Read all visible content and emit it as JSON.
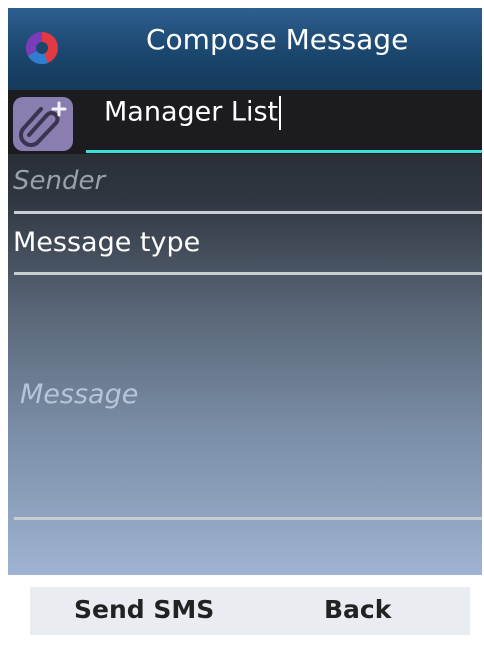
{
  "header": {
    "title": "Compose Message",
    "logo_icon": "app-logo-icon"
  },
  "form": {
    "attach_icon": "paperclip-add-icon",
    "recipient_value": "Manager List",
    "sender_placeholder": "Sender",
    "message_type_label": "Message type",
    "message_placeholder": "Message"
  },
  "softkeys": {
    "left_label": "Send SMS",
    "right_label": "Back"
  },
  "colors": {
    "header": "#1b466e",
    "accent_underline": "#3ce0dc",
    "attach_button": "#8a7eb0"
  }
}
